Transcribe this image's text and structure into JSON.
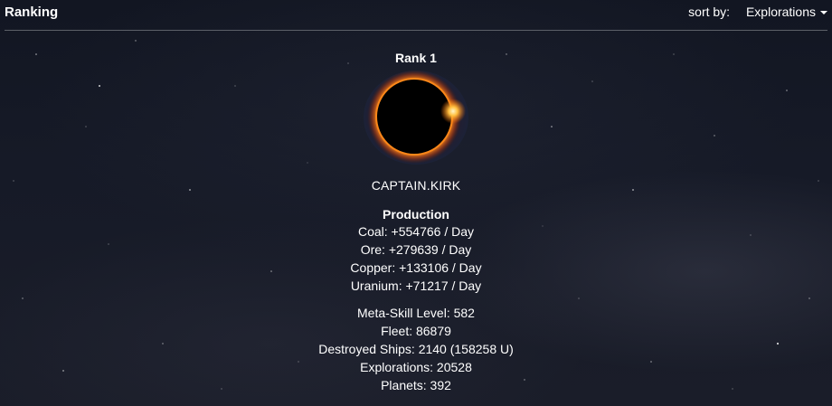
{
  "header": {
    "title": "Ranking",
    "sort_label": "sort by:",
    "sort_value": "Explorations"
  },
  "card": {
    "rank": "Rank 1",
    "name": "CAPTAIN.KIRK",
    "production_title": "Production",
    "production": [
      "Coal: +554766 / Day",
      "Ore: +279639 / Day",
      "Copper: +133106 / Day",
      "Uranium: +71217 / Day"
    ],
    "stats": [
      "Meta-Skill Level: 582",
      "Fleet: 86879",
      "Destroyed Ships: 2140 (158258 U)",
      "Explorations: 20528",
      "Planets: 392"
    ]
  },
  "colors": {
    "background": "#161a27",
    "divider": "#5c6068",
    "text": "#ffffff",
    "eclipse_glow": "#ff8a1a"
  },
  "icons": {
    "sort_caret": "caret-down-icon",
    "avatar": "eclipse-avatar"
  }
}
